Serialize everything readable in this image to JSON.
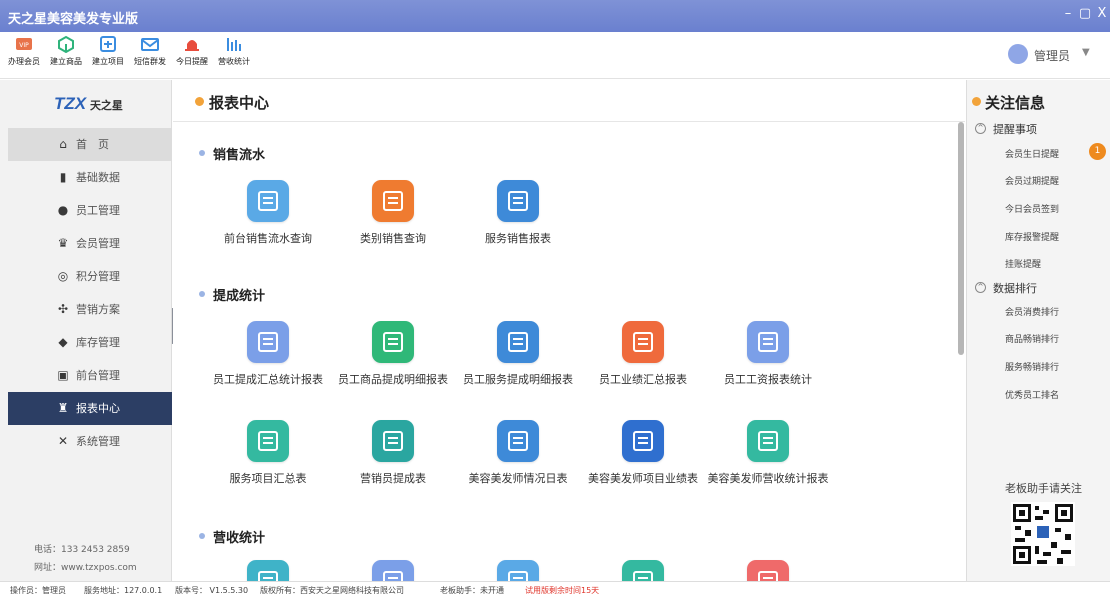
{
  "window": {
    "title": "天之星美容美发专业版",
    "controls": [
      "–",
      "▢",
      "X"
    ]
  },
  "toolbar": {
    "items": [
      {
        "label": "办理会员",
        "icon": "vip-card-icon",
        "color": "#e8734a"
      },
      {
        "label": "建立商品",
        "icon": "cube-icon",
        "color": "#2fb37b"
      },
      {
        "label": "建立项目",
        "icon": "add-item-icon",
        "color": "#3b8de0"
      },
      {
        "label": "短信群发",
        "icon": "envelope-icon",
        "color": "#3b8de0"
      },
      {
        "label": "今日提醒",
        "icon": "alarm-bell-icon",
        "color": "#e84d3d"
      },
      {
        "label": "营收统计",
        "icon": "bar-chart-icon",
        "color": "#3b8de0"
      }
    ],
    "user": {
      "name": "管理员",
      "caret": "▼"
    }
  },
  "sidebar": {
    "logo": {
      "mark": "TZX",
      "name": "天之星"
    },
    "items": [
      {
        "label": "首　页",
        "icon": "home-icon",
        "glyph": "⌂"
      },
      {
        "label": "基础数据",
        "icon": "bar-chart-icon",
        "glyph": "▮"
      },
      {
        "label": "员工管理",
        "icon": "staff-icon",
        "glyph": "●"
      },
      {
        "label": "会员管理",
        "icon": "crown-icon",
        "glyph": "♛"
      },
      {
        "label": "积分管理",
        "icon": "points-icon",
        "glyph": "◎"
      },
      {
        "label": "营销方案",
        "icon": "marketing-icon",
        "glyph": "✣"
      },
      {
        "label": "库存管理",
        "icon": "box-icon",
        "glyph": "◆"
      },
      {
        "label": "前台管理",
        "icon": "desk-icon",
        "glyph": "▣"
      },
      {
        "label": "报表中心",
        "icon": "report-icon",
        "glyph": "♜"
      },
      {
        "label": "系统管理",
        "icon": "tools-icon",
        "glyph": "✕"
      }
    ],
    "phone": "电话：133 2453 2859",
    "website": "网址：www.tzxpos.com"
  },
  "main": {
    "title": "报表中心",
    "sections": [
      {
        "title": "销售流水",
        "tiles": [
          {
            "label": "前台销售流水查询",
            "icon": "monitor-icon",
            "color": "#5aa9e6"
          },
          {
            "label": "类别销售查询",
            "icon": "grid-icon",
            "color": "#ef7b30"
          },
          {
            "label": "服务销售报表",
            "icon": "list-icon",
            "color": "#3e8ad8"
          }
        ]
      },
      {
        "title": "提成统计",
        "tiles": [
          {
            "label": "员工提成汇总统计报表",
            "icon": "clipboard-chart-icon",
            "color": "#7b9fe8"
          },
          {
            "label": "员工商品提成明细报表",
            "icon": "chart-card-icon",
            "color": "#2fb878"
          },
          {
            "label": "员工服务提成明细报表",
            "icon": "chart-doc-icon",
            "color": "#3e8ad8"
          },
          {
            "label": "员工业绩汇总报表",
            "icon": "layers-icon",
            "color": "#ef6a3c"
          },
          {
            "label": "员工工资报表统计",
            "icon": "yen-icon",
            "color": "#7b9fe8"
          }
        ]
      },
      {
        "title": "",
        "tiles": [
          {
            "label": "服务项目汇总表",
            "icon": "form-icon",
            "color": "#34b9a0"
          },
          {
            "label": "营销员提成表",
            "icon": "cubes-icon",
            "color": "#2aa6a0"
          },
          {
            "label": "美容美发师情况日表",
            "icon": "list-icon",
            "color": "#3e8ad8"
          },
          {
            "label": "美容美发师项目业绩表",
            "icon": "grid-icon",
            "color": "#2f6fcf"
          },
          {
            "label": "美容美发师营收统计报表",
            "icon": "receipt-icon",
            "color": "#34b9a0"
          }
        ]
      },
      {
        "title": "营收统计",
        "tiles": [
          {
            "label": "",
            "icon": "wallet-icon",
            "color": "#3fb3c8"
          },
          {
            "label": "",
            "icon": "doc-icon",
            "color": "#7b9fe8"
          },
          {
            "label": "",
            "icon": "table-icon",
            "color": "#5aa9e6"
          },
          {
            "label": "",
            "icon": "calendar-icon",
            "color": "#34b9a0"
          },
          {
            "label": "",
            "icon": "bag-icon",
            "color": "#ef6a6a"
          }
        ]
      }
    ]
  },
  "right": {
    "title": "关注信息",
    "groups": [
      {
        "title": "提醒事项",
        "items": [
          "会员生日提醒",
          "会员过期提醒",
          "今日会员签到",
          "库存报警提醒",
          "挂账提醒"
        ],
        "badge": "1"
      },
      {
        "title": "数据排行",
        "items": [
          "会员消费排行",
          "商品畅销排行",
          "服务畅销排行",
          "优秀员工排名"
        ]
      }
    ],
    "follow": "老板助手请关注"
  },
  "statusbar": {
    "operator": "操作员：管理员",
    "server": "服务地址：127.0.0.1",
    "version": "版本号： V1.5.5.30",
    "copyright": "版权所有：西安天之星网络科技有限公司",
    "assistant": "老板助手：未开通",
    "trial": "试用版剩余时间15天"
  },
  "colors": {
    "titlebar": "#6a80cf",
    "sidebar_active": "#2c3e64",
    "accent_orange": "#f2a33a",
    "badge": "#ee8a1e"
  }
}
